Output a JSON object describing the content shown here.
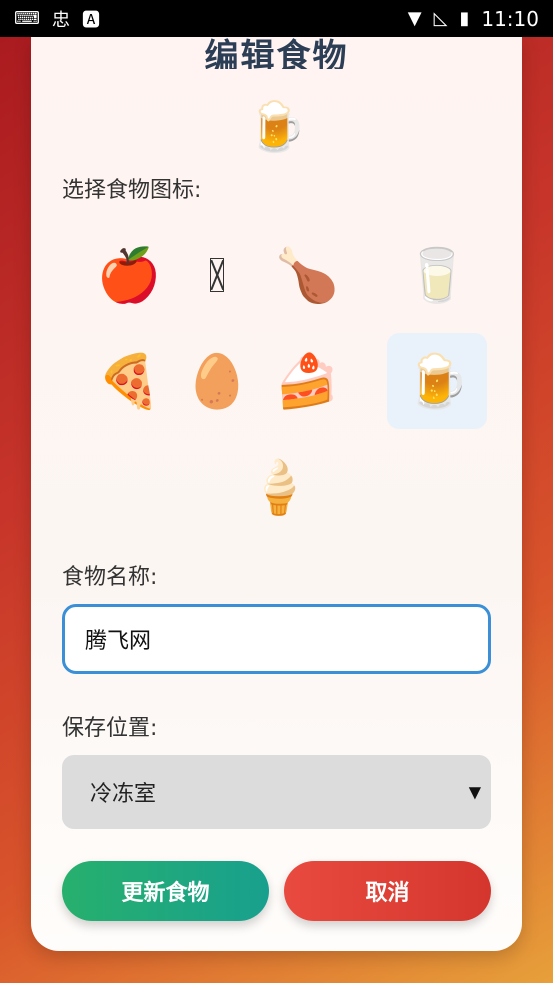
{
  "status_bar": {
    "left_icons": [
      "keyboard-icon",
      "app-icon",
      "font-icon"
    ],
    "time": "11:10",
    "right_icons": [
      "wifi-icon",
      "no-signal-icon",
      "battery-charging-icon"
    ]
  },
  "dialog": {
    "title": "编辑食物",
    "preview_icon": "🍺",
    "icon_section_label": "选择食物图标:",
    "food_icons": [
      {
        "glyph": "🍎",
        "name": "apple"
      },
      {
        "glyph": "",
        "name": "missing-glyph"
      },
      {
        "glyph": "🍗",
        "name": "drumstick"
      },
      {
        "glyph": "🥛",
        "name": "milk"
      },
      {
        "glyph": "🍕",
        "name": "pizza"
      },
      {
        "glyph": "🥚",
        "name": "egg"
      },
      {
        "glyph": "🍰",
        "name": "cake"
      },
      {
        "glyph": "🍺",
        "name": "beer",
        "selected": true
      },
      {
        "glyph": "🍦",
        "name": "ice-cream"
      }
    ],
    "name_label": "食物名称:",
    "name_value": "腾飞网",
    "location_label": "保存位置:",
    "location_value": "冷冻室",
    "update_button": "更新食物",
    "cancel_button": "取消"
  },
  "colors": {
    "accent_blue": "#3a8fd6",
    "update_green": "#27b06d",
    "cancel_red": "#e94a3f",
    "title_color": "#2c3e55"
  }
}
